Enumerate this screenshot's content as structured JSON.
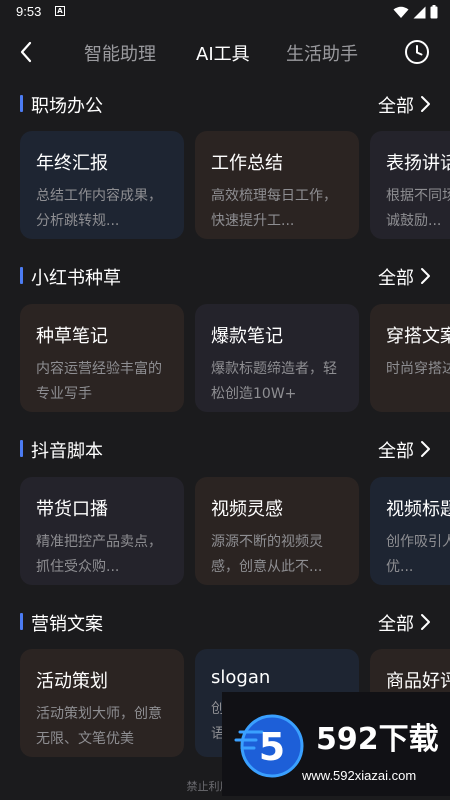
{
  "status": {
    "time": "9:53",
    "notification": "A"
  },
  "appbar": {
    "tabs": [
      {
        "label": "智能助理"
      },
      {
        "label": "AI工具"
      },
      {
        "label": "生活助手"
      }
    ],
    "active_tab": "AI工具"
  },
  "sections": [
    {
      "title": "职场办公",
      "all": "全部",
      "cards": [
        {
          "title": "年终汇报",
          "desc": "总结工作内容成果，分析跳转规..."
        },
        {
          "title": "工作总结",
          "desc": "高效梳理每日工作，快速提升工..."
        },
        {
          "title": "表扬讲话",
          "desc": "根据不同场景生成真诚鼓励..."
        }
      ]
    },
    {
      "title": "小红书种草",
      "all": "全部",
      "cards": [
        {
          "title": "种草笔记",
          "desc": "内容运营经验丰富的专业写手"
        },
        {
          "title": "爆款笔记",
          "desc": "爆款标题缔造者，轻松创造10W+"
        },
        {
          "title": "穿搭文案",
          "desc": "时尚穿搭达人文案"
        }
      ]
    },
    {
      "title": "抖音脚本",
      "all": "全部",
      "cards": [
        {
          "title": "带货口播",
          "desc": "精准把控产品卖点，抓住受众购..."
        },
        {
          "title": "视频灵感",
          "desc": "源源不断的视频灵感，创意从此不..."
        },
        {
          "title": "视频标题",
          "desc": "创作吸引人的标题，优..."
        }
      ]
    },
    {
      "title": "营销文案",
      "all": "全部",
      "cards": [
        {
          "title": "活动策划",
          "desc": "活动策划大师，创意无限、文笔优美"
        },
        {
          "title": "slogan",
          "desc": "创作朗朗上口的广告语"
        },
        {
          "title": "商品好评",
          "desc": ""
        }
      ]
    }
  ],
  "footer": {
    "text": "禁止利用功能从"
  },
  "watermark": {
    "brand": "592下载",
    "url": "www.592xiazai.com",
    "logo_digit": "5"
  },
  "colors": {
    "background": "#1b1b1d",
    "accent": "#4c7cf3",
    "text_secondary": "#8e8e92"
  }
}
